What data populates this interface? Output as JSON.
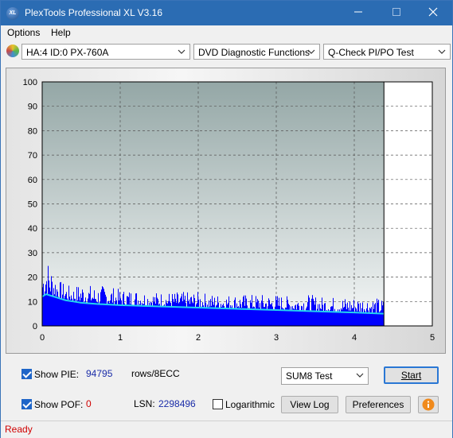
{
  "window": {
    "title": "PlexTools Professional XL V3.16",
    "icon_text": "XL",
    "controls": [
      "minimize-icon",
      "maximize-icon",
      "close-icon"
    ]
  },
  "menu": {
    "items": [
      {
        "label": "Options",
        "mnemonic": "O"
      },
      {
        "label": "Help",
        "mnemonic": "H"
      }
    ]
  },
  "toolbar": {
    "drive": "HA:4 ID:0  PX-760A",
    "function": "DVD Diagnostic Functions",
    "test": "Q-Check PI/PO Test"
  },
  "chart_data": {
    "type": "bar",
    "xlim": [
      0,
      5
    ],
    "ylim": [
      0,
      100
    ],
    "x_ticks": [
      "0",
      "1",
      "2",
      "3",
      "4",
      "5"
    ],
    "y_ticks": [
      "0",
      "10",
      "20",
      "30",
      "40",
      "50",
      "60",
      "70",
      "80",
      "90",
      "100"
    ],
    "grid": true,
    "data_end_x": 4.38,
    "series": [
      {
        "kind": "bars",
        "color": "#0000ff",
        "x": [
          0.0,
          0.05,
          0.1,
          0.15,
          0.2,
          0.3,
          0.4,
          0.5,
          0.6,
          0.7,
          0.8,
          0.9,
          1.0,
          1.2,
          1.4,
          1.6,
          1.8,
          2.0,
          2.2,
          2.4,
          2.6,
          2.8,
          3.0,
          3.2,
          3.4,
          3.6,
          3.8,
          4.0,
          4.2,
          4.38
        ],
        "values": [
          24,
          29,
          25,
          22,
          19,
          17,
          16,
          18,
          17,
          16,
          17,
          16,
          15,
          15,
          14,
          14,
          14,
          14,
          13,
          13,
          13,
          13,
          13,
          12,
          13,
          12,
          12,
          12,
          12,
          11
        ]
      },
      {
        "kind": "line",
        "color": "#22d3f0",
        "x": [
          0.0,
          0.05,
          0.1,
          0.2,
          0.3,
          0.4,
          0.5,
          0.7,
          1.0,
          1.5,
          2.0,
          2.5,
          3.0,
          3.5,
          4.0,
          4.38
        ],
        "values": [
          12,
          13,
          12.5,
          11.5,
          10.5,
          10,
          9.5,
          9,
          8.5,
          8,
          7.5,
          7,
          6.5,
          6,
          5.5,
          5
        ]
      }
    ],
    "colors": {
      "plot_top": "#94a7a6",
      "plot_bottom": "#f6f8f8",
      "blank_region": "#ffffff"
    }
  },
  "bottom": {
    "show_pie_label": "Show PIE:",
    "show_pie_checked": true,
    "pie_value": "94795",
    "pie_unit": "rows/8ECC",
    "show_pof_label": "Show POF:",
    "show_pof_checked": true,
    "pof_value": "0",
    "lsn_label": "LSN:",
    "lsn_value": "2298496",
    "log_label": "Logarithmic",
    "log_checked": false,
    "mode_select": "SUM8 Test",
    "start_label": "Start",
    "view_log_label": "View Log",
    "preferences_label": "Preferences"
  },
  "status": {
    "text": "Ready"
  }
}
